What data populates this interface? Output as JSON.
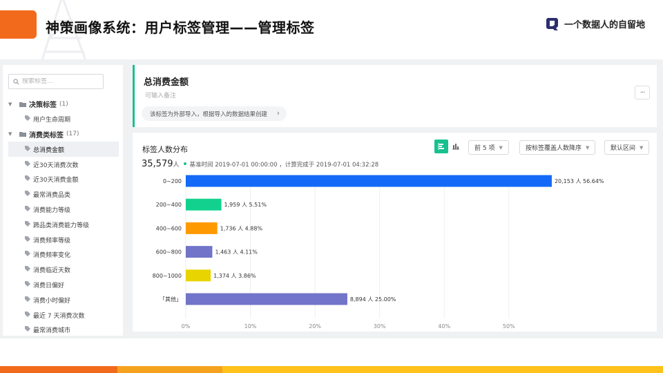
{
  "slide": {
    "title": "神策画像系统：用户标签管理——管理标签",
    "brand": "一个数据人的自留地"
  },
  "sidebar": {
    "search_placeholder": "搜索标签...",
    "groups": [
      {
        "name": "决策标签",
        "count": "(1)",
        "items": [
          "用户生命周期"
        ]
      },
      {
        "name": "消费类标签",
        "count": "(17)",
        "items": [
          "总消费金额",
          "近30天消费次数",
          "近30天消费金额",
          "最常消费品类",
          "消费能力等级",
          "跨品类消费能力等级",
          "消费频率等级",
          "消费频率变化",
          "消费临近天数",
          "消费日偏好",
          "消费小时偏好",
          "最近 7 天消费次数",
          "最常消费城市"
        ]
      }
    ],
    "active_item": "总消费金额"
  },
  "tag_header": {
    "title": "总消费金额",
    "note": "可输入备注",
    "info": "该标签为外部导入，根据导入的数据结果创建",
    "more": "···"
  },
  "distribution": {
    "title": "标签人数分布",
    "total": "35,579",
    "total_unit": "人",
    "time_info": "基准时间 2019-07-01 00:00:00 ，计算完成于 2019-07-01 04:32:28",
    "controls": {
      "top_n": "前 5 项",
      "sort": "按标签覆盖人数降序",
      "interval": "默认区间"
    },
    "icons": {
      "bar_view": "bar-chart-icon",
      "column_view": "column-chart-icon"
    }
  },
  "chart_data": {
    "type": "bar",
    "orientation": "horizontal",
    "categories": [
      "0~200",
      "200~400",
      "400~600",
      "600~800",
      "800~1000",
      "「其他」"
    ],
    "values": [
      56.64,
      5.51,
      4.88,
      4.11,
      3.86,
      25.0
    ],
    "labels": [
      "20,153 人 56.64%",
      "1,959 人 5.51%",
      "1,736 人 4.88%",
      "1,463 人 4.11%",
      "1,374 人 3.86%",
      "8,894 人 25.00%"
    ],
    "colors": [
      "#1469f6",
      "#12d18e",
      "#ff9900",
      "#7174c8",
      "#e8d400",
      "#7174c8"
    ],
    "xticks": [
      "0%",
      "10%",
      "20%",
      "30%",
      "40%",
      "50%"
    ],
    "xlim": [
      0,
      57.5
    ],
    "grid": true
  },
  "footer_colors": [
    "#f26b1d",
    "#f5a31f",
    "#ffc21a"
  ]
}
